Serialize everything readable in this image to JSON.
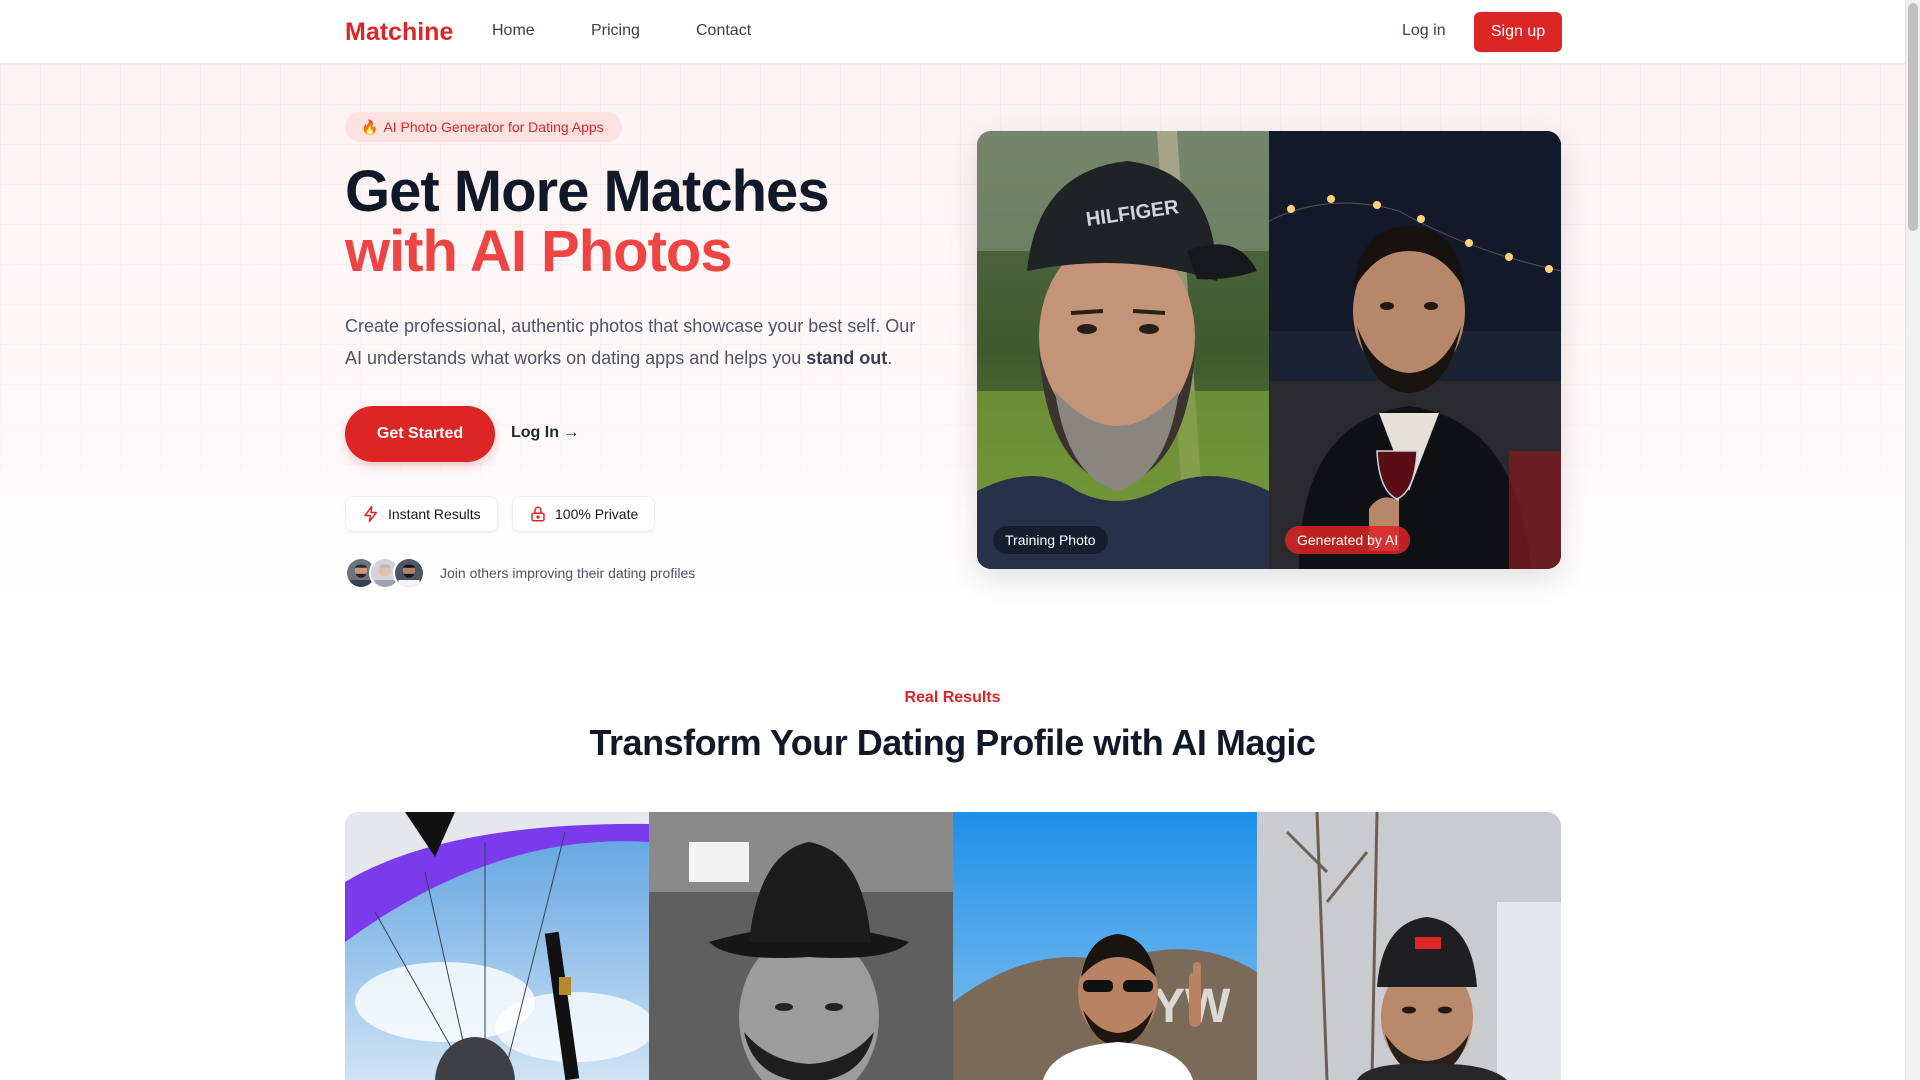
{
  "header": {
    "logo": "Matchine",
    "nav": {
      "home": "Home",
      "pricing": "Pricing",
      "contact": "Contact"
    },
    "login": "Log in",
    "signup": "Sign up"
  },
  "hero": {
    "pill_icon": "🔥",
    "pill_text": "AI Photo Generator for Dating Apps",
    "headline_line1": "Get More Matches",
    "headline_line2": "with AI Photos",
    "subtext_main": "Create professional, authentic photos that showcase your best self. Our AI understands what works on dating apps and helps you ",
    "subtext_bold": "stand out",
    "subtext_end": ".",
    "cta_primary": "Get Started",
    "cta_secondary": "Log In →",
    "features": {
      "instant": "Instant Results",
      "private": "100% Private"
    },
    "social_proof": "Join others improving their dating profiles",
    "compare_labels": {
      "training": "Training Photo",
      "generated": "Generated by AI"
    }
  },
  "results": {
    "eyebrow": "Real Results",
    "title": "Transform Your Dating Profile with AI Magic"
  },
  "colors": {
    "brand": "#dc2626",
    "accent_light": "#ef4444",
    "text_dark": "#111827"
  }
}
